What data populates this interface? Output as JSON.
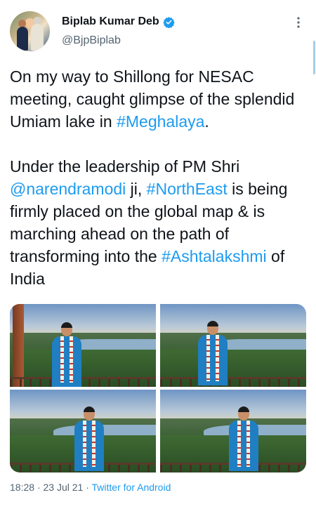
{
  "author": {
    "name": "Biplab Kumar Deb",
    "handle": "@BjpBiplab",
    "verified": true,
    "avatar_icon": "profile-photo"
  },
  "tweet": {
    "paragraph1": {
      "text": "On my way to Shillong for NESAC meeting, caught glimpse of the splendid Umiam lake in ",
      "hashtag": "#Meghalaya",
      "end": "."
    },
    "paragraph2": {
      "part1": "Under the leadership of PM Shri ",
      "mention": "@narendramodi",
      "part2": " ji, ",
      "hashtag1": "#NorthEast",
      "part3": " is being firmly placed on the global map & is marching ahead on the path of transforming into the ",
      "hashtag2": "#Ashtalakshmi",
      "part4": " of India"
    }
  },
  "media": {
    "photo_count": 4,
    "photos": [
      "photo-1",
      "photo-2",
      "photo-3",
      "photo-4"
    ]
  },
  "meta": {
    "time": "18:28",
    "separator": "·",
    "date": "23 Jul 21",
    "source": "Twitter for Android"
  },
  "colors": {
    "link": "#1d9bf0",
    "text": "#0f1419",
    "secondary": "#536471"
  },
  "icons": [
    "verified-badge-icon",
    "more-options-icon"
  ]
}
